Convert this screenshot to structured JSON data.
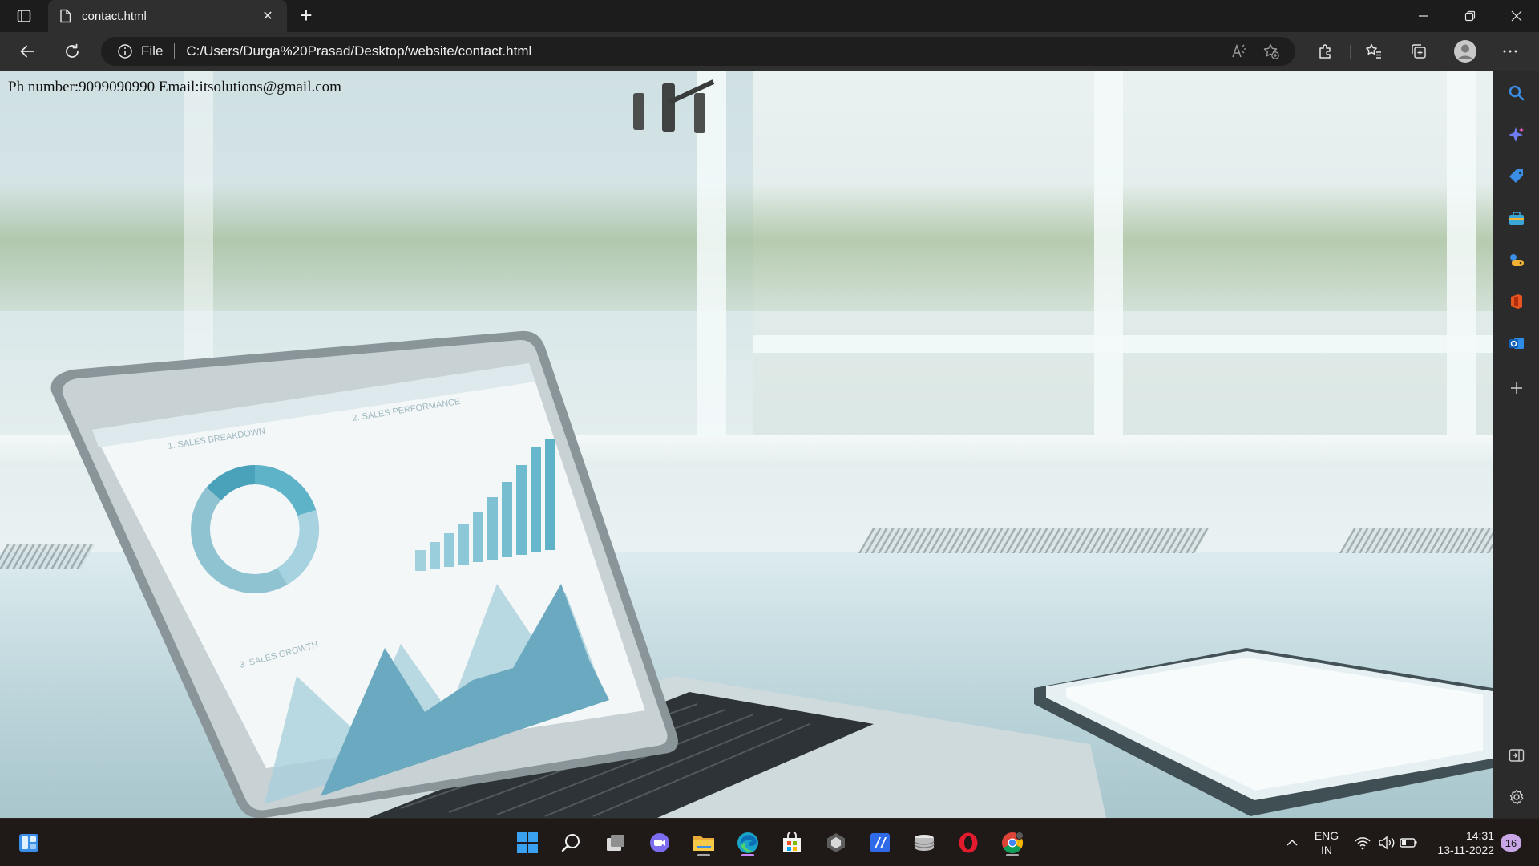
{
  "browser": {
    "tab": {
      "title": "contact.html"
    },
    "address": {
      "scheme_label": "File",
      "url": "C:/Users/Durga%20Prasad/Desktop/website/contact.html"
    }
  },
  "page": {
    "contact_line": "Ph number:9099090990 Email:itsolutions@gmail.com",
    "screen_labels": [
      "1. SALES BREAKDOWN",
      "2. SALES PERFORMANCE",
      "3. SALES GROWTH"
    ]
  },
  "taskbar": {
    "language": {
      "line1": "ENG",
      "line2": "IN"
    },
    "clock": {
      "time": "14:31",
      "date": "13-11-2022"
    },
    "notification_count": "16"
  },
  "colors": {
    "edge_accent": "#c58af9",
    "chart_teal": "#5fb3c9"
  }
}
